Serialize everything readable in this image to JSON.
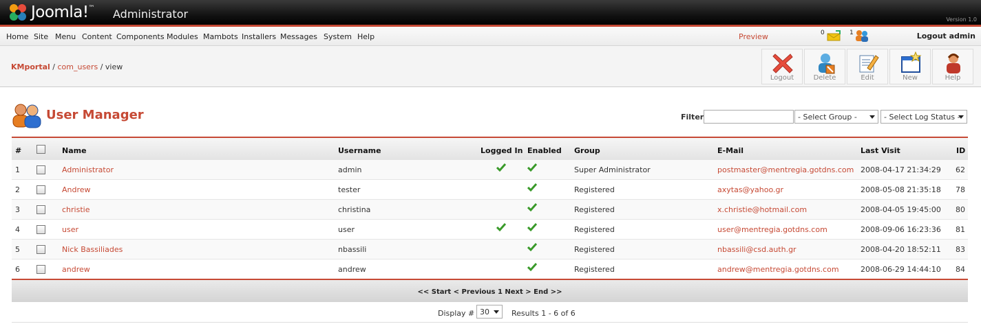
{
  "header": {
    "brand": "Joomla!",
    "subtitle": "Administrator",
    "version": "Version 1.0"
  },
  "menu": [
    "Home",
    "Site",
    "Menu",
    "Content",
    "Components",
    "Modules",
    "Mambots",
    "Installers",
    "Messages",
    "System",
    "Help"
  ],
  "menubar": {
    "preview": "Preview",
    "messages_count": "0",
    "users_count": "1",
    "logout": "Logout admin"
  },
  "breadcrumb": {
    "site": "KMportal",
    "component": "com_users",
    "view": "view"
  },
  "toolbar": {
    "logout": "Logout",
    "delete": "Delete",
    "edit": "Edit",
    "new": "New",
    "help": "Help"
  },
  "page": {
    "title": "User Manager",
    "filter_label": "Filter:",
    "filter_value": "",
    "group_select": "- Select Group -",
    "log_select": "- Select Log Status -"
  },
  "table": {
    "headers": {
      "num": "#",
      "name": "Name",
      "username": "Username",
      "logged_in": "Logged In",
      "enabled": "Enabled",
      "group": "Group",
      "email": "E-Mail",
      "last_visit": "Last Visit",
      "id": "ID"
    },
    "rows": [
      {
        "num": "1",
        "name": "Administrator",
        "username": "admin",
        "logged_in": true,
        "enabled": true,
        "group": "Super Administrator",
        "email": "postmaster@mentregia.gotdns.com",
        "last_visit": "2008-04-17 21:34:29",
        "id": "62"
      },
      {
        "num": "2",
        "name": "Andrew",
        "username": "tester",
        "logged_in": false,
        "enabled": true,
        "group": "Registered",
        "email": "axytas@yahoo.gr",
        "last_visit": "2008-05-08 21:35:18",
        "id": "78"
      },
      {
        "num": "3",
        "name": "christie",
        "username": "christina",
        "logged_in": false,
        "enabled": true,
        "group": "Registered",
        "email": "x.christie@hotmail.com",
        "last_visit": "2008-04-05 19:45:00",
        "id": "80"
      },
      {
        "num": "4",
        "name": "user",
        "username": "user",
        "logged_in": true,
        "enabled": true,
        "group": "Registered",
        "email": "user@mentregia.gotdns.com",
        "last_visit": "2008-09-06 16:23:36",
        "id": "81"
      },
      {
        "num": "5",
        "name": "Nick Bassiliades",
        "username": "nbassili",
        "logged_in": false,
        "enabled": true,
        "group": "Registered",
        "email": "nbassili@csd.auth.gr",
        "last_visit": "2008-04-20 18:52:11",
        "id": "83"
      },
      {
        "num": "6",
        "name": "andrew",
        "username": "andrew",
        "logged_in": false,
        "enabled": true,
        "group": "Registered",
        "email": "andrew@mentregia.gotdns.com",
        "last_visit": "2008-06-29 14:44:10",
        "id": "84"
      }
    ]
  },
  "pagination": {
    "nav": "<< Start < Previous 1 Next > End >>",
    "display_label": "Display #",
    "display_value": "30",
    "results": "Results 1 - 6 of 6"
  },
  "colors": {
    "accent": "#c64934",
    "check": "#3a9a2a"
  }
}
